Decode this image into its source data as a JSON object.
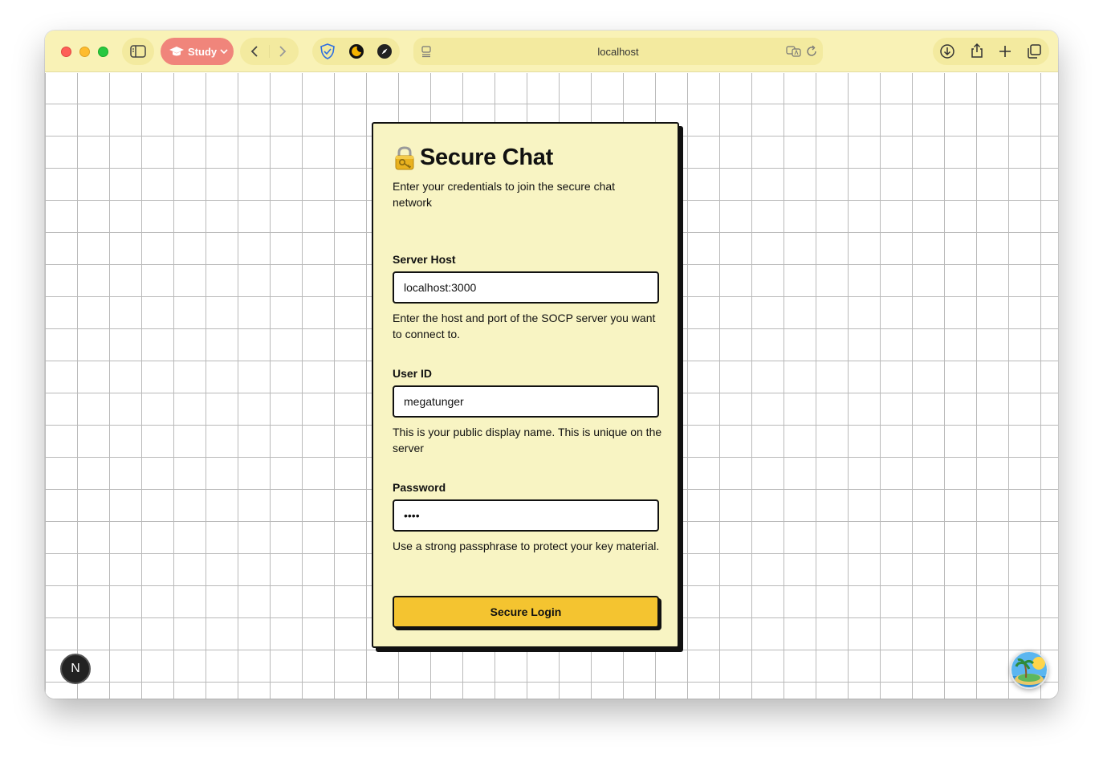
{
  "browser": {
    "address": "localhost",
    "study_label": "Study",
    "accent_color": "#f0857b",
    "toolbar_color": "#f9f2b6"
  },
  "login": {
    "title": "Secure Chat",
    "subtitle": "Enter your credentials to join the secure chat network",
    "server_host": {
      "label": "Server Host",
      "value": "localhost:3000",
      "help": "Enter the host and port of the SOCP server you want to connect to."
    },
    "user_id": {
      "label": "User ID",
      "value": "megatunger",
      "help": "This is your public display name. This is unique on the server"
    },
    "password": {
      "label": "Password",
      "value": "abcd",
      "help": "Use a strong passphrase to protect your key material."
    },
    "submit_label": "Secure Login"
  },
  "dev_badge": "N",
  "colors": {
    "card_bg": "#f8f4c3",
    "button_bg": "#f4c430",
    "border": "#111111"
  }
}
